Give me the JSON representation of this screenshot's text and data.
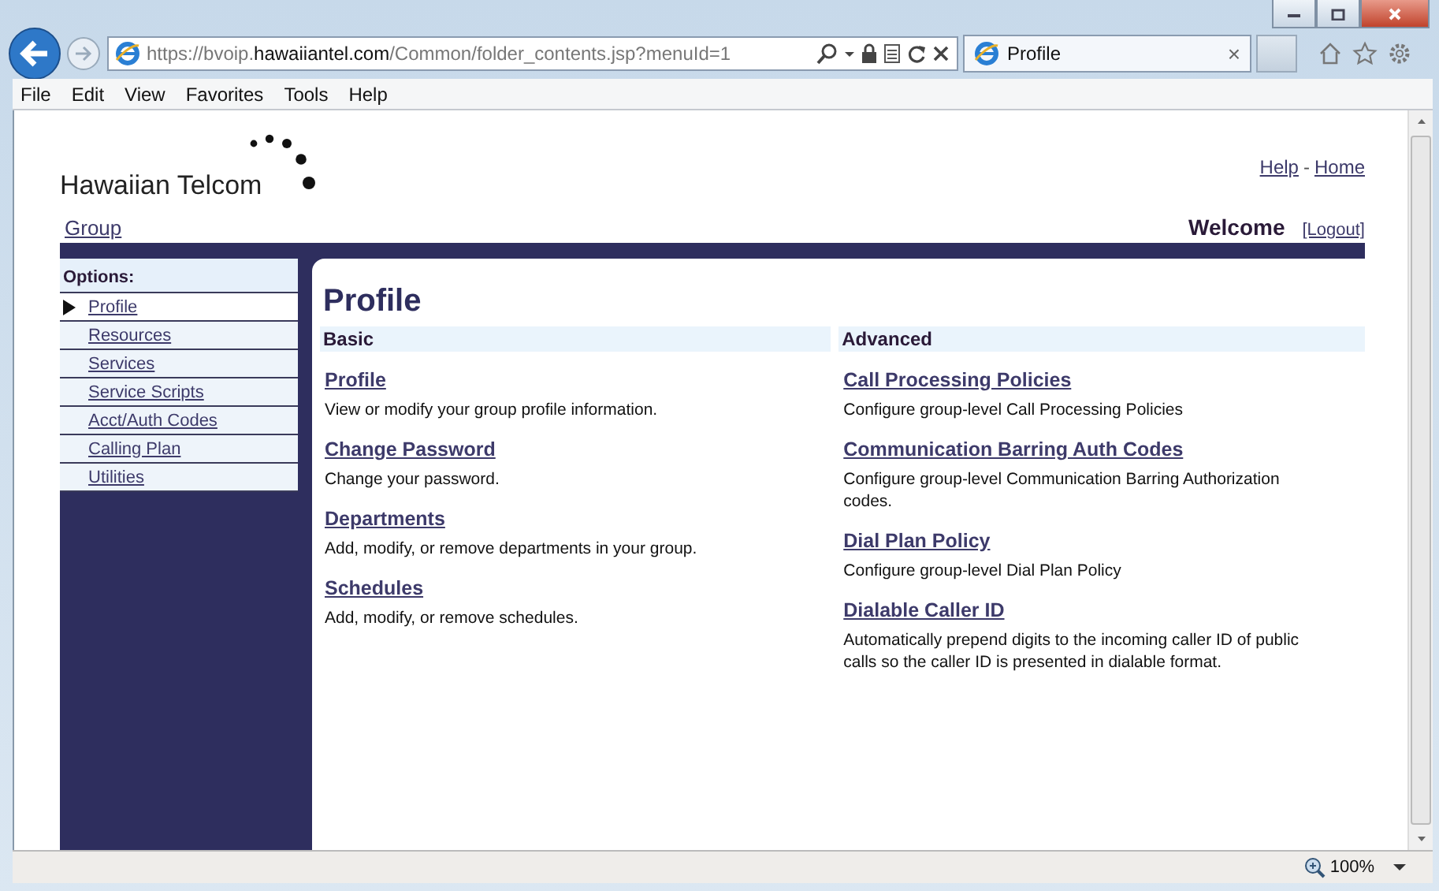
{
  "browser": {
    "url": "https://bvoip.**hawaiiantel.com**/Common/folder_contents.jsp?menuId=1",
    "tab": {
      "title": "Profile",
      "close": "×"
    },
    "menu": [
      "File",
      "Edit",
      "View",
      "Favorites",
      "Tools",
      "Help"
    ],
    "zoom": "100%"
  },
  "page": {
    "logo": "Hawaiian Telcom",
    "top_links": [
      "Help",
      "Home"
    ],
    "separator": "-",
    "group_link": "Group",
    "welcome": "Welcome",
    "logout": "[Logout]",
    "sidebar": {
      "heading": "Options:",
      "items": [
        {
          "label": "Profile",
          "selected": true
        },
        {
          "label": "Resources",
          "selected": false
        },
        {
          "label": "Services",
          "selected": false
        },
        {
          "label": "Service Scripts",
          "selected": false
        },
        {
          "label": "Acct/Auth Codes",
          "selected": false
        },
        {
          "label": "Calling Plan",
          "selected": false
        },
        {
          "label": "Utilities",
          "selected": false
        }
      ]
    },
    "title": "Profile",
    "sections": [
      {
        "heading": "Basic",
        "entries": [
          {
            "link": "Profile",
            "description": "View or modify your group profile information."
          },
          {
            "link": "Change Password",
            "description": "Change your password."
          },
          {
            "link": "Departments",
            "description": "Add, modify, or remove departments in your group."
          },
          {
            "link": "Schedules",
            "description": "Add, modify, or remove schedules."
          }
        ]
      },
      {
        "heading": "Advanced",
        "entries": [
          {
            "link": "Call Processing Policies",
            "description": "Configure group-level Call Processing Policies"
          },
          {
            "link": "Communication Barring Auth Codes",
            "description": "Configure group-level Communication Barring Authorization codes."
          },
          {
            "link": "Dial Plan Policy",
            "description": "Configure group-level Dial Plan Policy"
          },
          {
            "link": "Dialable Caller ID",
            "description": "Automatically prepend digits to the incoming caller ID of public calls so the caller ID is presented in dialable format."
          }
        ]
      }
    ]
  }
}
